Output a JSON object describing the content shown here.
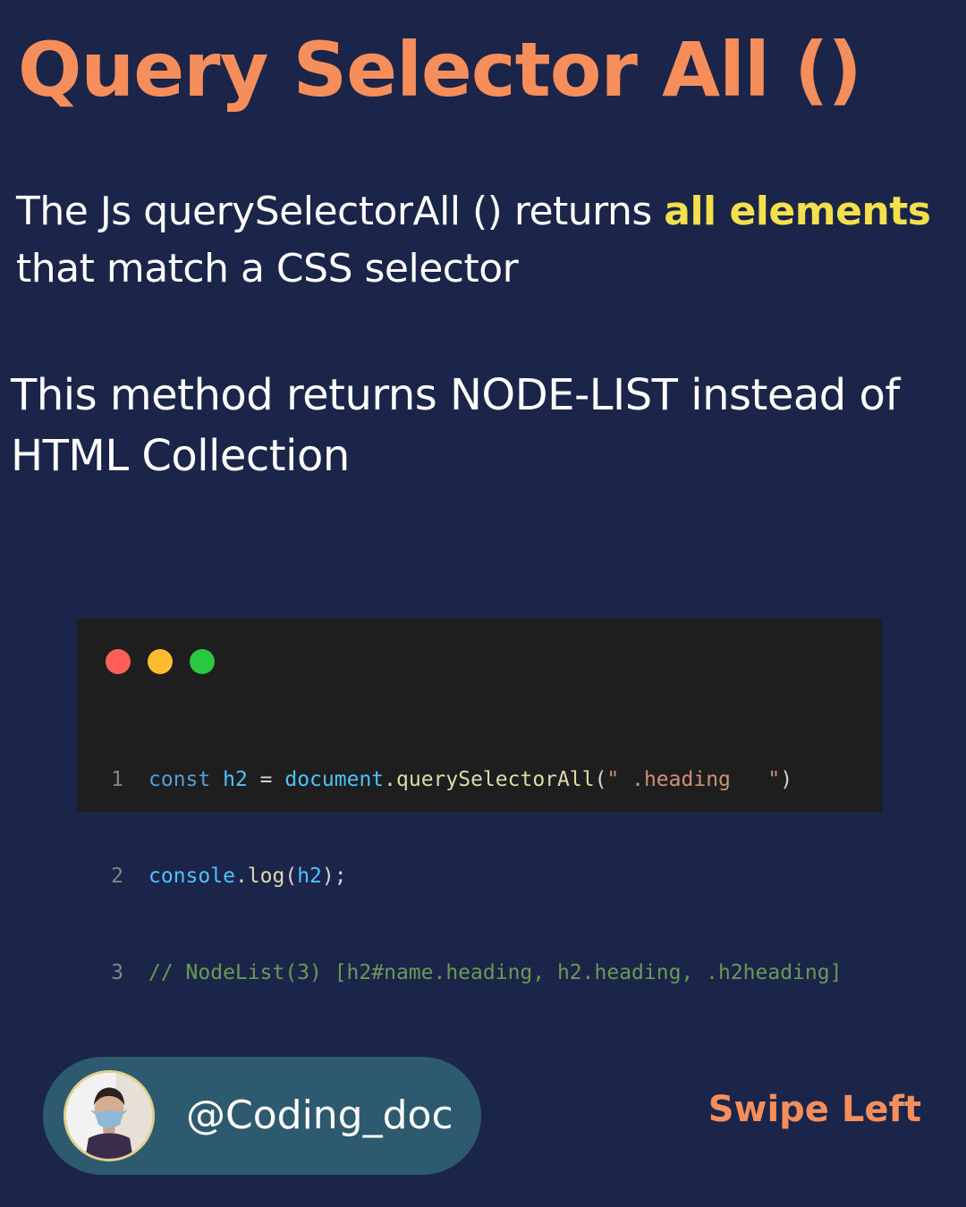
{
  "title": "Query Selector All ()",
  "paragraph1": {
    "before": "The Js querySelectorAll () returns ",
    "highlight": "all elements",
    "after": " that match a CSS selector"
  },
  "paragraph2": "This method returns NODE-LIST instead of HTML Collection",
  "code": {
    "line_numbers": [
      "1",
      "2",
      "3"
    ],
    "line1": {
      "kw": "const",
      "var": "h2",
      "eq": " = ",
      "obj": "document",
      "dot": ".",
      "fn": "querySelectorAll",
      "open": "(",
      "str": "\" .heading   \"",
      "close": ")"
    },
    "line2": {
      "obj": "console",
      "dot": ".",
      "fn": "log",
      "open": "(",
      "var": "h2",
      "close": ");"
    },
    "line3": "// NodeList(3) [h2#name.heading, h2.heading, .h2heading]"
  },
  "profile": {
    "handle": "@Coding_doc"
  },
  "swipe": "Swipe Left",
  "colors": {
    "background": "#1b2549",
    "accent": "#f58e5a",
    "highlight": "#f4e04d",
    "pill": "#2e5a70"
  },
  "icons": {
    "window_controls": [
      "red-dot-icon",
      "yellow-dot-icon",
      "green-dot-icon"
    ],
    "avatar": "avatar-photo"
  }
}
